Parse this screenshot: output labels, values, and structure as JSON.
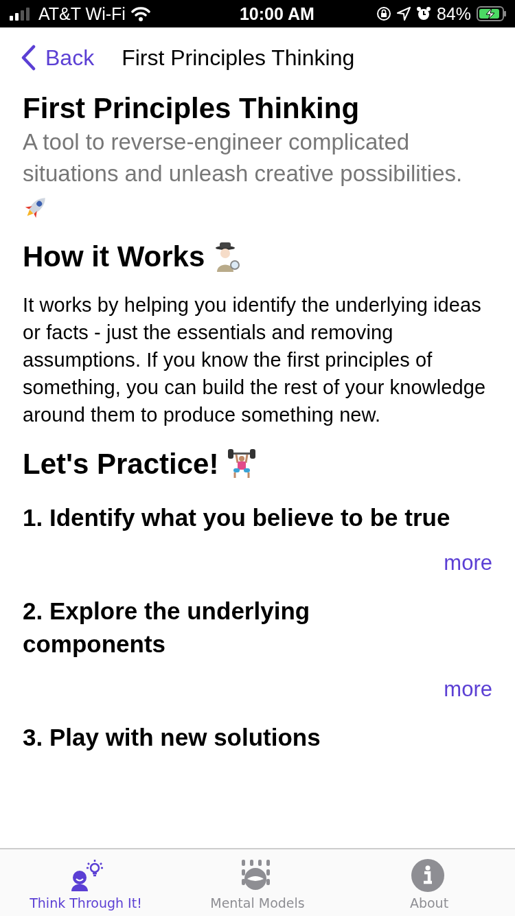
{
  "status_bar": {
    "carrier": "AT&T Wi-Fi",
    "time": "10:00 AM",
    "battery": "84%"
  },
  "nav": {
    "back": "Back",
    "title": "First Principles Thinking"
  },
  "title": "First Principles Thinking",
  "subtitle": "A tool to reverse-engineer complicated situations and unleash creative possibilities.",
  "how_heading": "How it Works",
  "how_text": "It works by helping you identify the underlying ideas or facts - just the essentials and removing assumptions. If you know the first principles of something, you can build the rest of your knowledge around them to produce something new.",
  "practice_heading": "Let's Practice!",
  "steps": [
    {
      "title": "1. Identify what you believe to be true",
      "more": "more"
    },
    {
      "title": "2. Explore the underlying components",
      "more": "more"
    },
    {
      "title": "3. Play with new solutions"
    }
  ],
  "tabs": [
    {
      "label": "Think Through It!",
      "kind": "think",
      "selected": true
    },
    {
      "label": "Mental Models",
      "kind": "models",
      "selected": false
    },
    {
      "label": "About",
      "kind": "about",
      "selected": false
    }
  ]
}
